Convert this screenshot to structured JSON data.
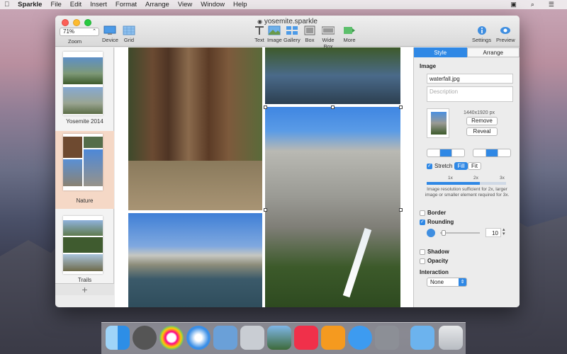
{
  "menubar": {
    "app": "Sparkle",
    "items": [
      "File",
      "Edit",
      "Insert",
      "Format",
      "Arrange",
      "View",
      "Window",
      "Help"
    ]
  },
  "window": {
    "title": "yosemite.sparkle"
  },
  "toolbar": {
    "zoom_value": "71%",
    "zoom_label": "Zoom",
    "device_label": "Device",
    "grid_label": "Grid",
    "text_label": "Text",
    "image_label": "Image",
    "gallery_label": "Gallery",
    "box_label": "Box",
    "widebox_label": "Wide Box",
    "more_label": "More",
    "settings_label": "Settings",
    "preview_label": "Preview"
  },
  "sidebar": {
    "pages": [
      {
        "label": "Yosemite 2014"
      },
      {
        "label": "Nature"
      },
      {
        "label": "Trails"
      }
    ],
    "add_label": "+"
  },
  "inspector": {
    "tabs": [
      "Style",
      "Arrange"
    ],
    "image_heading": "Image",
    "filename": "waterfall.jpg",
    "description_placeholder": "Description",
    "dimensions": "1440x1920 px",
    "remove_label": "Remove",
    "reveal_label": "Reveal",
    "stretch_label": "Stretch",
    "fill_label": "Fill",
    "fit_label": "Fit",
    "scale_ticks": [
      "1x",
      "2x",
      "3x"
    ],
    "resolution_note": "Image resolution sufficient for 2x, larger image or smaller element required for 3x.",
    "resolution_fraction": 0.67,
    "border_label": "Border",
    "rounding_label": "Rounding",
    "rounding_value": "10",
    "shadow_label": "Shadow",
    "opacity_label": "Opacity",
    "interaction_heading": "Interaction",
    "interaction_value": "None"
  },
  "colors": {
    "accent": "#2f88e5",
    "sidebar_selected": "#f5d8c6"
  }
}
